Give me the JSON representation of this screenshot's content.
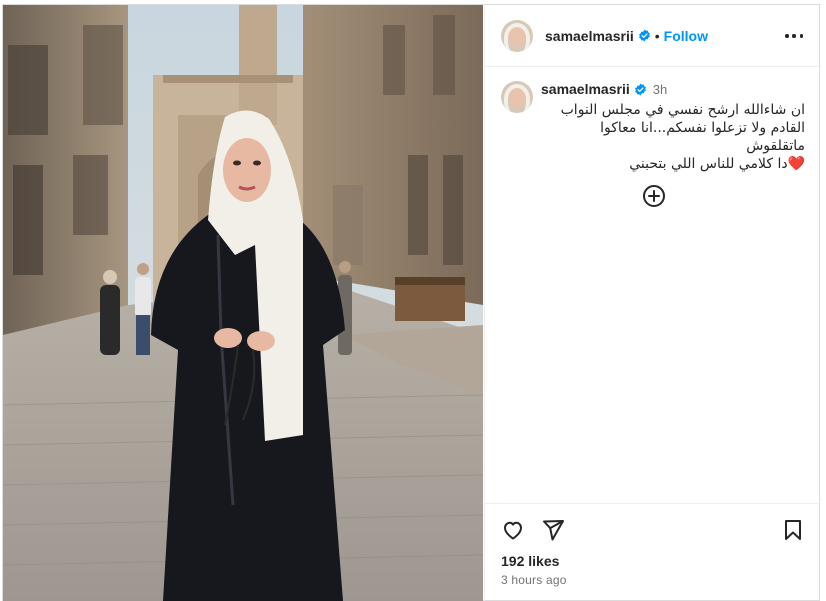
{
  "post": {
    "username": "samaelmasrii",
    "verified": true,
    "follow_label": "Follow",
    "separator": "•",
    "more_icon": "more-options-icon"
  },
  "caption": {
    "username": "samaelmasrii",
    "time": "3h",
    "text": "ان شاءالله ارشح نفسي في مجلس النواب\nالقادم ولا تزعلوا نفسكم...انا معاكوا ماتقلقوش\n❤️دا كلامي للناس اللي بتحبني"
  },
  "comments": {
    "load_more_icon": "plus-circle-icon"
  },
  "actions": {
    "like_icon": "heart-icon",
    "share_icon": "paper-plane-icon",
    "save_icon": "bookmark-icon",
    "likes_text": "192 likes",
    "time_ago": "3 hours ago"
  },
  "colors": {
    "accent": "#0095f6",
    "verified": "#0095f6",
    "text": "#262626",
    "muted": "#737373"
  }
}
